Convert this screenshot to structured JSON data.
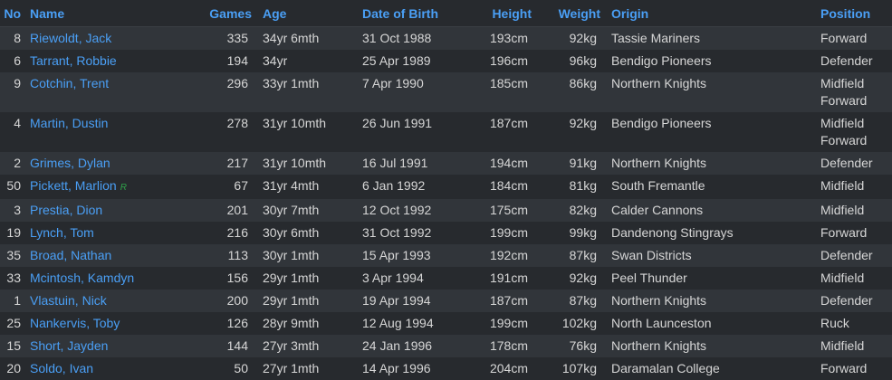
{
  "headers": {
    "no": "No",
    "name": "Name",
    "games": "Games",
    "age": "Age",
    "dob": "Date of Birth",
    "height": "Height",
    "weight": "Weight",
    "origin": "Origin",
    "position": "Position"
  },
  "players": [
    {
      "no": "8",
      "name": "Riewoldt, Jack",
      "games": "335",
      "age": "34yr 6mth",
      "dob": "31 Oct 1988",
      "height": "193cm",
      "weight": "92kg",
      "origin": "Tassie Mariners",
      "position": [
        "Forward"
      ]
    },
    {
      "no": "6",
      "name": "Tarrant, Robbie",
      "games": "194",
      "age": "34yr",
      "dob": "25 Apr 1989",
      "height": "196cm",
      "weight": "96kg",
      "origin": "Bendigo Pioneers",
      "position": [
        "Defender"
      ]
    },
    {
      "no": "9",
      "name": "Cotchin, Trent",
      "games": "296",
      "age": "33yr 1mth",
      "dob": "7 Apr 1990",
      "height": "185cm",
      "weight": "86kg",
      "origin": "Northern Knights",
      "position": [
        "Midfield",
        "Forward"
      ]
    },
    {
      "no": "4",
      "name": "Martin, Dustin",
      "games": "278",
      "age": "31yr 10mth",
      "dob": "26 Jun 1991",
      "height": "187cm",
      "weight": "92kg",
      "origin": "Bendigo Pioneers",
      "position": [
        "Midfield",
        "Forward"
      ]
    },
    {
      "no": "2",
      "name": "Grimes, Dylan",
      "games": "217",
      "age": "31yr 10mth",
      "dob": "16 Jul 1991",
      "height": "194cm",
      "weight": "91kg",
      "origin": "Northern Knights",
      "position": [
        "Defender"
      ]
    },
    {
      "no": "50",
      "name": "Pickett, Marlion",
      "badge": "R",
      "games": "67",
      "age": "31yr 4mth",
      "dob": "6 Jan 1992",
      "height": "184cm",
      "weight": "81kg",
      "origin": "South Fremantle",
      "position": [
        "Midfield"
      ]
    },
    {
      "no": "3",
      "name": "Prestia, Dion",
      "games": "201",
      "age": "30yr 7mth",
      "dob": "12 Oct 1992",
      "height": "175cm",
      "weight": "82kg",
      "origin": "Calder Cannons",
      "position": [
        "Midfield"
      ]
    },
    {
      "no": "19",
      "name": "Lynch, Tom",
      "games": "216",
      "age": "30yr 6mth",
      "dob": "31 Oct 1992",
      "height": "199cm",
      "weight": "99kg",
      "origin": "Dandenong Stingrays",
      "position": [
        "Forward"
      ]
    },
    {
      "no": "35",
      "name": "Broad, Nathan",
      "games": "113",
      "age": "30yr 1mth",
      "dob": "15 Apr 1993",
      "height": "192cm",
      "weight": "87kg",
      "origin": "Swan Districts",
      "position": [
        "Defender"
      ]
    },
    {
      "no": "33",
      "name": "Mcintosh, Kamdyn",
      "games": "156",
      "age": "29yr 1mth",
      "dob": "3 Apr 1994",
      "height": "191cm",
      "weight": "92kg",
      "origin": "Peel Thunder",
      "position": [
        "Midfield"
      ]
    },
    {
      "no": "1",
      "name": "Vlastuin, Nick",
      "games": "200",
      "age": "29yr 1mth",
      "dob": "19 Apr 1994",
      "height": "187cm",
      "weight": "87kg",
      "origin": "Northern Knights",
      "position": [
        "Defender"
      ]
    },
    {
      "no": "25",
      "name": "Nankervis, Toby",
      "games": "126",
      "age": "28yr 9mth",
      "dob": "12 Aug 1994",
      "height": "199cm",
      "weight": "102kg",
      "origin": "North Launceston",
      "position": [
        "Ruck"
      ]
    },
    {
      "no": "15",
      "name": "Short, Jayden",
      "games": "144",
      "age": "27yr 3mth",
      "dob": "24 Jan 1996",
      "height": "178cm",
      "weight": "76kg",
      "origin": "Northern Knights",
      "position": [
        "Midfield"
      ]
    },
    {
      "no": "20",
      "name": "Soldo, Ivan",
      "games": "50",
      "age": "27yr 1mth",
      "dob": "14 Apr 1996",
      "height": "204cm",
      "weight": "107kg",
      "origin": "Daramalan College",
      "position": [
        "Forward"
      ]
    }
  ]
}
